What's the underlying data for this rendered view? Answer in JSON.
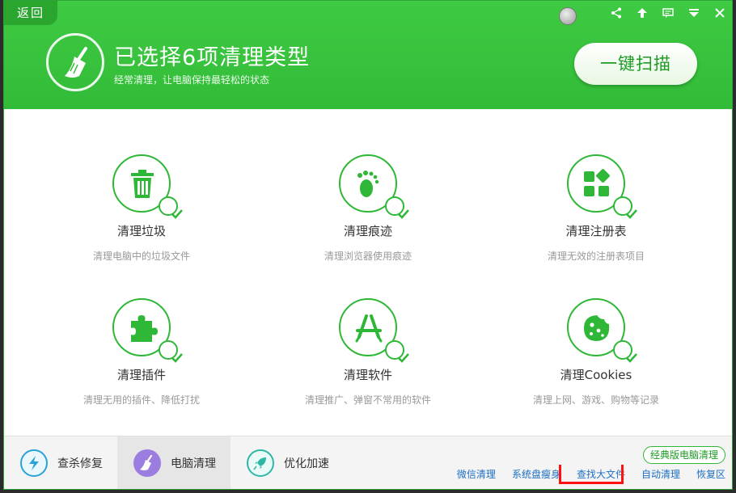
{
  "header": {
    "back_label": "返回",
    "title": "已选择6项清理类型",
    "subtitle": "经常清理，让电脑保持最轻松的状态",
    "scan_label": "一键扫描",
    "tool_icons": [
      "share-icon",
      "pin-icon",
      "feedback-icon",
      "menu-icon",
      "close-icon"
    ]
  },
  "items": [
    {
      "title": "清理垃圾",
      "desc": "清理电脑中的垃圾文件",
      "icon": "trash-icon"
    },
    {
      "title": "清理痕迹",
      "desc": "清理浏览器使用痕迹",
      "icon": "footprint-icon"
    },
    {
      "title": "清理注册表",
      "desc": "清理无效的注册表项目",
      "icon": "registry-icon"
    },
    {
      "title": "清理插件",
      "desc": "清理无用的插件、降低打扰",
      "icon": "puzzle-icon"
    },
    {
      "title": "清理软件",
      "desc": "清理推广、弹窗不常用的软件",
      "icon": "appstore-icon"
    },
    {
      "title": "清理Cookies",
      "desc": "清理上网、游戏、购物等记录",
      "icon": "cookie-icon"
    }
  ],
  "bottom": {
    "nav": [
      {
        "label": "查杀修复",
        "icon": "lightning-icon"
      },
      {
        "label": "电脑清理",
        "icon": "broom-icon",
        "active": true
      },
      {
        "label": "优化加速",
        "icon": "rocket-icon"
      }
    ],
    "classic_label": "经典版电脑清理",
    "links": [
      "微信清理",
      "系统盘瘦身",
      "查找大文件",
      "自动清理",
      "恢复区"
    ]
  },
  "colors": {
    "accent": "#34be3a",
    "link": "#1d6fc2",
    "highlight": "#ff1111"
  }
}
